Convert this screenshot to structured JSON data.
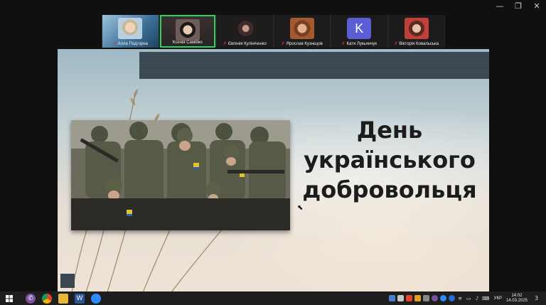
{
  "window": {
    "controls": {
      "minimize": "—",
      "restore": "❐",
      "close": "✕"
    }
  },
  "participants": [
    {
      "name": "Алла Подгорна",
      "muted": true,
      "active": false
    },
    {
      "name": "Ксенія Самійко",
      "muted": false,
      "active": true
    },
    {
      "name": "Євгенія Кулініченко",
      "muted": true,
      "active": false
    },
    {
      "name": "Ярослав Кузнєцов",
      "muted": true,
      "active": false
    },
    {
      "name": "Катя Лукьянчук",
      "muted": true,
      "active": false,
      "avatar_letter": "K",
      "avatar_color": "#5b5fd6"
    },
    {
      "name": "Вікторія Ковальська",
      "muted": true,
      "active": false
    }
  ],
  "slide": {
    "title_lines": [
      "День",
      "українського",
      "добровольця"
    ]
  },
  "taskbar": {
    "language": "УКР",
    "time": "14:02",
    "date": "14.03.2025",
    "notification_count": "3"
  },
  "colors": {
    "active_speaker_border": "#2bd35f",
    "muted_icon": "#e53935",
    "taskbar_bg": "#1e1e1e"
  }
}
